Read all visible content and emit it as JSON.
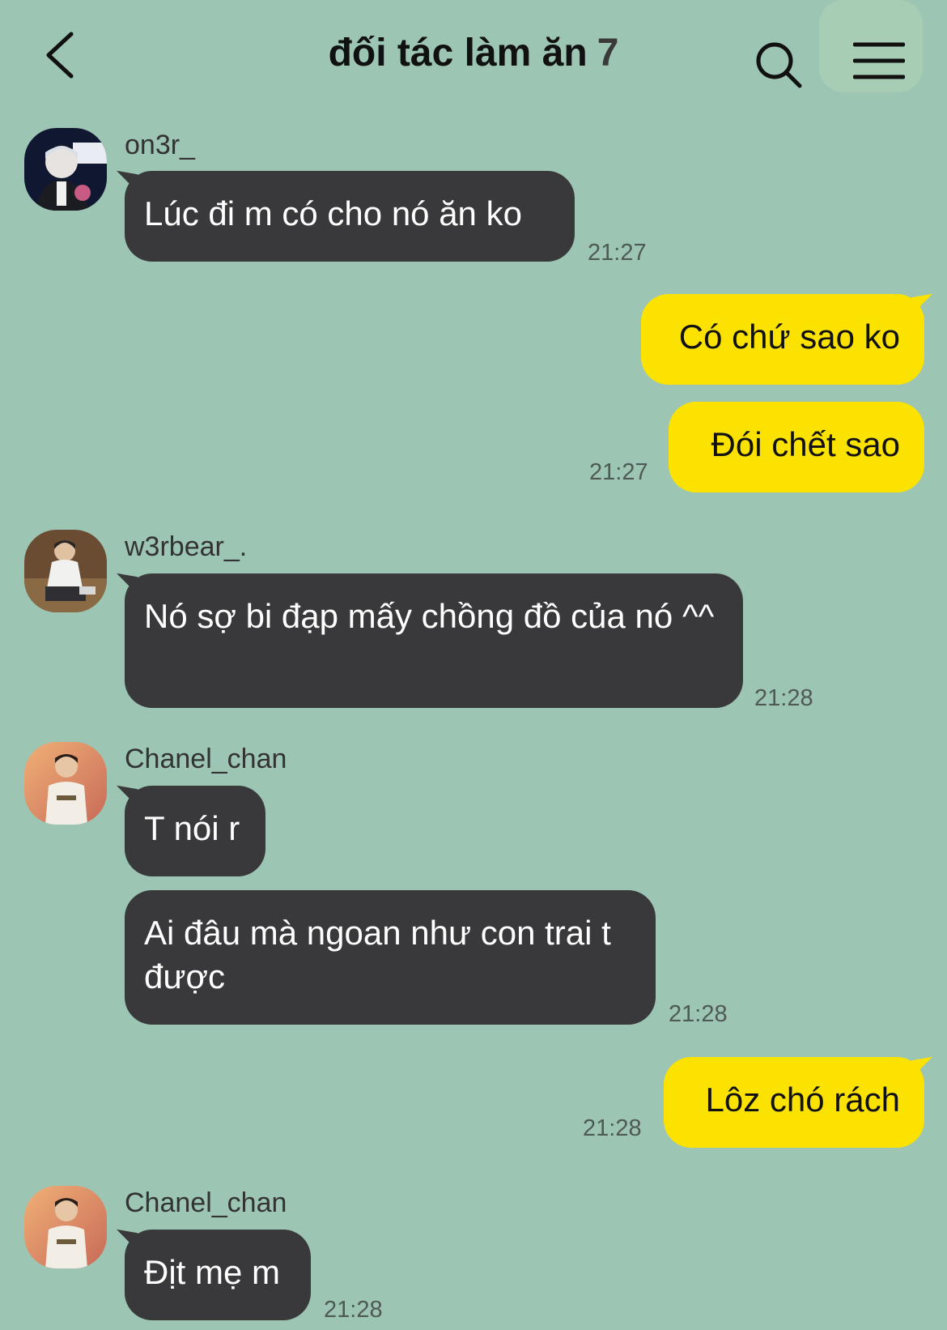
{
  "header": {
    "title": "đối tác làm ăn",
    "member_count": "7"
  },
  "colors": {
    "background": "#9cc5b4",
    "incoming_bubble": "#39393b",
    "outgoing_bubble": "#fbe200"
  },
  "icons": {
    "back": "chevron-left-icon",
    "search": "search-icon",
    "menu": "hamburger-menu-icon"
  },
  "messages": [
    {
      "sender": "on3r_",
      "text": "Lúc đi m có cho nó ăn ko",
      "time": "21:27"
    },
    {
      "outgoing": true,
      "text": "Có chứ sao ko"
    },
    {
      "outgoing": true,
      "text": "Đói chết sao",
      "time": "21:27"
    },
    {
      "sender": "w3rbear_.",
      "text": "Nó sợ bi đạp mấy chồng đồ của nó ^^",
      "time": "21:28"
    },
    {
      "sender": "Chanel_chan",
      "text": "T nói r"
    },
    {
      "text": "Ai đâu mà ngoan như con trai t được",
      "time": "21:28"
    },
    {
      "outgoing": true,
      "text": "Lôz chó rách",
      "time": "21:28"
    },
    {
      "sender": "Chanel_chan",
      "text": "Địt mẹ m",
      "time": "21:28"
    }
  ]
}
